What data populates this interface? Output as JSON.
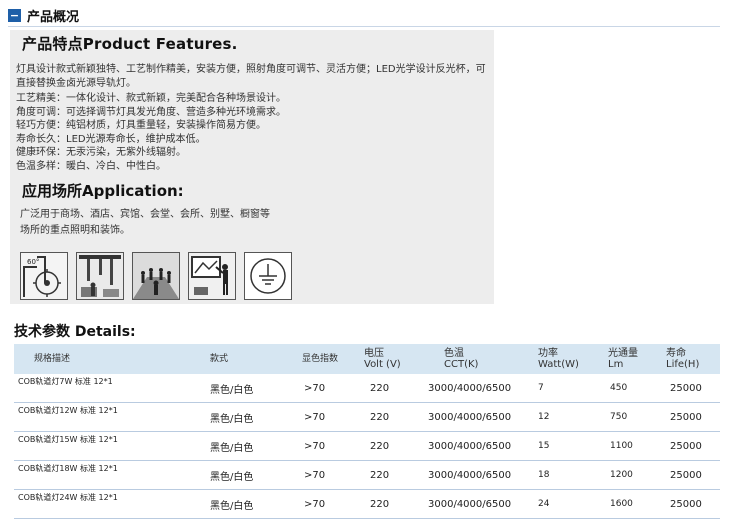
{
  "section": {
    "icon": "minus-icon",
    "title": "产品概况"
  },
  "features": {
    "heading": "产品特点Product Features.",
    "intro": "灯具设计款式新颖独特、工艺制作精美，安装方便，照射角度可调节、灵活方便；LED光学设计反光杯，可直接替换金卤光源导轨灯。",
    "items": [
      "工艺精美：一体化设计、款式新颖，完美配合各种场景设计。",
      "角度可调：可选择调节灯具发光角度、营造多种光环境需求。",
      "轻巧方便：纯铝材质，灯具重量轻，安装操作简易方便。",
      "寿命长久：LED光源寿命长，维护成本低。",
      "健康环保：无汞污染，无紫外线辐射。",
      "色温多样：暖白、冷白、中性白。"
    ]
  },
  "application": {
    "heading": "应用场所Application:",
    "line1": "广泛用于商场、酒店、宾馆、会堂、会所、别墅、橱窗等",
    "line2": "场所的重点照明和装饰。",
    "icons": [
      "adjustable-angle-icon",
      "track-lights-icon",
      "audience-hall-icon",
      "presentation-room-icon",
      "ground-symbol-icon"
    ],
    "icon_label": "60°"
  },
  "details": {
    "heading": "技术参数 Details:",
    "headers": [
      {
        "l1": "规格描述",
        "l2": ""
      },
      {
        "l1": "款式",
        "l2": ""
      },
      {
        "l1": "显色指数",
        "l2": ""
      },
      {
        "l1": "电压",
        "l2": "Volt (V)"
      },
      {
        "l1": "色温",
        "l2": "CCT(K)"
      },
      {
        "l1": "功率",
        "l2": "Watt(W)"
      },
      {
        "l1": "光通量",
        "l2": "Lm"
      },
      {
        "l1": "寿命",
        "l2": "Life(H)"
      }
    ],
    "rows": [
      {
        "spec": "COB轨道灯7W 标准 12*1",
        "style": "黑色/白色",
        "cri": ">70",
        "volt": "220",
        "cct": "3000/4000/6500",
        "watt": "7",
        "lm": "450",
        "life": "25000"
      },
      {
        "spec": "COB轨道灯12W 标准 12*1",
        "style": "黑色/白色",
        "cri": ">70",
        "volt": "220",
        "cct": "3000/4000/6500",
        "watt": "12",
        "lm": "750",
        "life": "25000"
      },
      {
        "spec": "COB轨道灯15W 标准 12*1",
        "style": "黑色/白色",
        "cri": ">70",
        "volt": "220",
        "cct": "3000/4000/6500",
        "watt": "15",
        "lm": "1100",
        "life": "25000"
      },
      {
        "spec": "COB轨道灯18W 标准 12*1",
        "style": "黑色/白色",
        "cri": ">70",
        "volt": "220",
        "cct": "3000/4000/6500",
        "watt": "18",
        "lm": "1200",
        "life": "25000"
      },
      {
        "spec": "COB轨道灯24W 标准 12*1",
        "style": "黑色/白色",
        "cri": ">70",
        "volt": "220",
        "cct": "3000/4000/6500",
        "watt": "24",
        "lm": "1600",
        "life": "25000"
      }
    ]
  },
  "colors": {
    "accent": "#1e5fa8",
    "panel": "#ededed",
    "table_header": "#d6e6f2",
    "row_rule": "#b9cbe0"
  }
}
